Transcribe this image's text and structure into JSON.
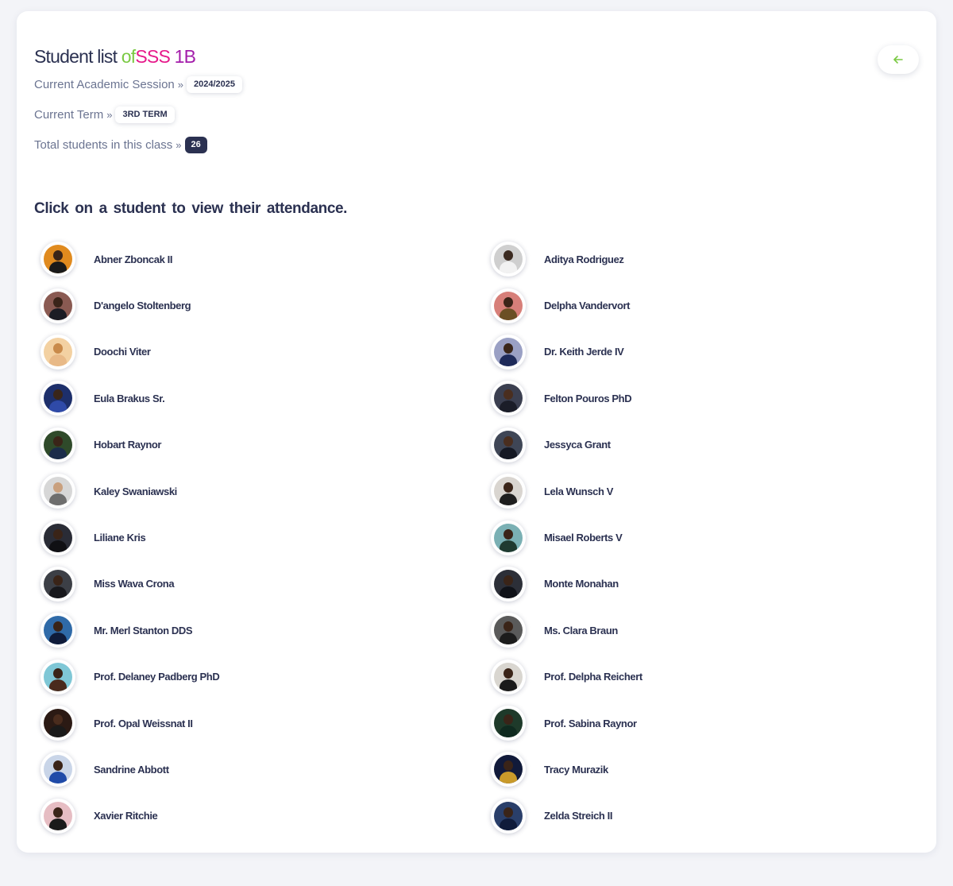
{
  "page": {
    "title": {
      "prefix": "Student list",
      "of": "of",
      "class_a": "SSS",
      "class_b": "1B"
    },
    "session": {
      "label": "Current Academic Session",
      "separator": "»",
      "value": "2024/2025"
    },
    "term": {
      "label": "Current Term",
      "separator": "»",
      "value": "3RD TERM"
    },
    "total": {
      "label": "Total students in this class",
      "separator": "»",
      "value": "26"
    },
    "instruction": "Click on a student to view their attendance.",
    "back_button": {
      "icon": "arrow-left-icon",
      "color": "#7ac943"
    }
  },
  "colors": {
    "primary_text": "#2b3151",
    "muted_text": "#6b7491",
    "accent_green": "#7ac943",
    "accent_pink": "#e6198a",
    "accent_purple": "#a31caa"
  },
  "students": [
    {
      "name": "Abner Zboncak II",
      "bg": "#e08a1e",
      "skin": "#3a2418",
      "cloth": "#1a1a1a"
    },
    {
      "name": "Aditya Rodriguez",
      "bg": "#cfcfcf",
      "skin": "#3b2a20",
      "cloth": "#f2f2f2"
    },
    {
      "name": "D'angelo Stoltenberg",
      "bg": "#8a5a52",
      "skin": "#3a2419",
      "cloth": "#1c1c24"
    },
    {
      "name": "Delpha Vandervort",
      "bg": "#d77f79",
      "skin": "#3b2418",
      "cloth": "#6b4f24"
    },
    {
      "name": "Doochi Viter",
      "bg": "#f3d1a2",
      "skin": "#c98a4a",
      "cloth": "#e8b987"
    },
    {
      "name": "Dr. Keith Jerde IV",
      "bg": "#9aa0c4",
      "skin": "#3a261a",
      "cloth": "#1e2a5a"
    },
    {
      "name": "Eula Brakus Sr.",
      "bg": "#1d2f6b",
      "skin": "#3a261a",
      "cloth": "#2f4aa8"
    },
    {
      "name": "Felton Pouros PhD",
      "bg": "#3b3f50",
      "skin": "#4a2e1f",
      "cloth": "#1b1d28"
    },
    {
      "name": "Hobart Raynor",
      "bg": "#2f4a2a",
      "skin": "#3a2418",
      "cloth": "#1b2c4a"
    },
    {
      "name": "Jessyca Grant",
      "bg": "#3f4656",
      "skin": "#4a2e1f",
      "cloth": "#151823"
    },
    {
      "name": "Kaley Swaniawski",
      "bg": "#d7d7d7",
      "skin": "#c9a07e",
      "cloth": "#6e6e6e"
    },
    {
      "name": "Lela Wunsch V",
      "bg": "#d9d5d0",
      "skin": "#3a2418",
      "cloth": "#1e1e1e"
    },
    {
      "name": "Liliane Kris",
      "bg": "#2a2c36",
      "skin": "#3a2418",
      "cloth": "#101014"
    },
    {
      "name": "Misael Roberts V",
      "bg": "#7ab0b4",
      "skin": "#3a2418",
      "cloth": "#1f3a30"
    },
    {
      "name": "Miss Wava Crona",
      "bg": "#3c3f46",
      "skin": "#3a2418",
      "cloth": "#18181c"
    },
    {
      "name": "Monte Monahan",
      "bg": "#2c2f38",
      "skin": "#3a2418",
      "cloth": "#101218"
    },
    {
      "name": "Mr. Merl Stanton DDS",
      "bg": "#2f6aa8",
      "skin": "#3a2418",
      "cloth": "#0f1b3a"
    },
    {
      "name": "Ms. Clara Braun",
      "bg": "#5a5a5a",
      "skin": "#3a2418",
      "cloth": "#1c1c1c"
    },
    {
      "name": "Prof. Delaney Padberg PhD",
      "bg": "#7fc7d6",
      "skin": "#3a2418",
      "cloth": "#4a2a1c"
    },
    {
      "name": "Prof. Delpha Reichert",
      "bg": "#d9d6d0",
      "skin": "#3a2418",
      "cloth": "#1a1a1a"
    },
    {
      "name": "Prof. Opal Weissnat II",
      "bg": "#2b1a14",
      "skin": "#4a2c1d",
      "cloth": "#1a1a1a"
    },
    {
      "name": "Prof. Sabina Raynor",
      "bg": "#1e3a2a",
      "skin": "#3a2418",
      "cloth": "#0f2a1f"
    },
    {
      "name": "Sandrine Abbott",
      "bg": "#c9d5e8",
      "skin": "#3a2418",
      "cloth": "#1f4aa8"
    },
    {
      "name": "Tracy Murazik",
      "bg": "#111a3a",
      "skin": "#3a2418",
      "cloth": "#c99a2a"
    },
    {
      "name": "Xavier Ritchie",
      "bg": "#e6bdc3",
      "skin": "#3a2418",
      "cloth": "#1a1a1a"
    },
    {
      "name": "Zelda Streich II",
      "bg": "#2a3f6a",
      "skin": "#3a2418",
      "cloth": "#0f1b3a"
    }
  ]
}
